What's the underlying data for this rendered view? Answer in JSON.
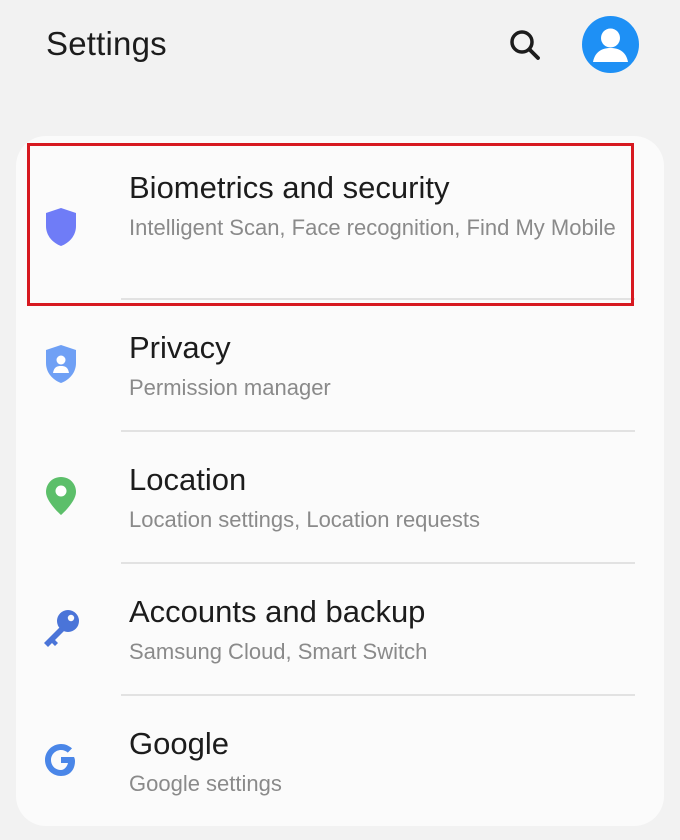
{
  "header": {
    "title": "Settings",
    "search_icon": "search-icon",
    "avatar_icon": "account-avatar-icon"
  },
  "colors": {
    "background": "#f2f2f2",
    "card": "#fbfbfb",
    "avatar": "#1e90f5",
    "biometrics_icon": "#6f7cf7",
    "privacy_icon": "#6fa0f5",
    "location_icon": "#5cbf6a",
    "accounts_icon": "#4a74d8",
    "highlight_border": "#d71920"
  },
  "items": [
    {
      "title": "Biometrics and security",
      "subtitle": "Intelligent Scan, Face recognition, Find My Mobile",
      "icon": "shield-icon"
    },
    {
      "title": "Privacy",
      "subtitle": "Permission manager",
      "icon": "privacy-shield-icon"
    },
    {
      "title": "Location",
      "subtitle": "Location settings, Location requests",
      "icon": "location-pin-icon"
    },
    {
      "title": "Accounts and backup",
      "subtitle": "Samsung Cloud, Smart Switch",
      "icon": "key-icon"
    },
    {
      "title": "Google",
      "subtitle": "Google settings",
      "icon": "google-icon"
    }
  ]
}
